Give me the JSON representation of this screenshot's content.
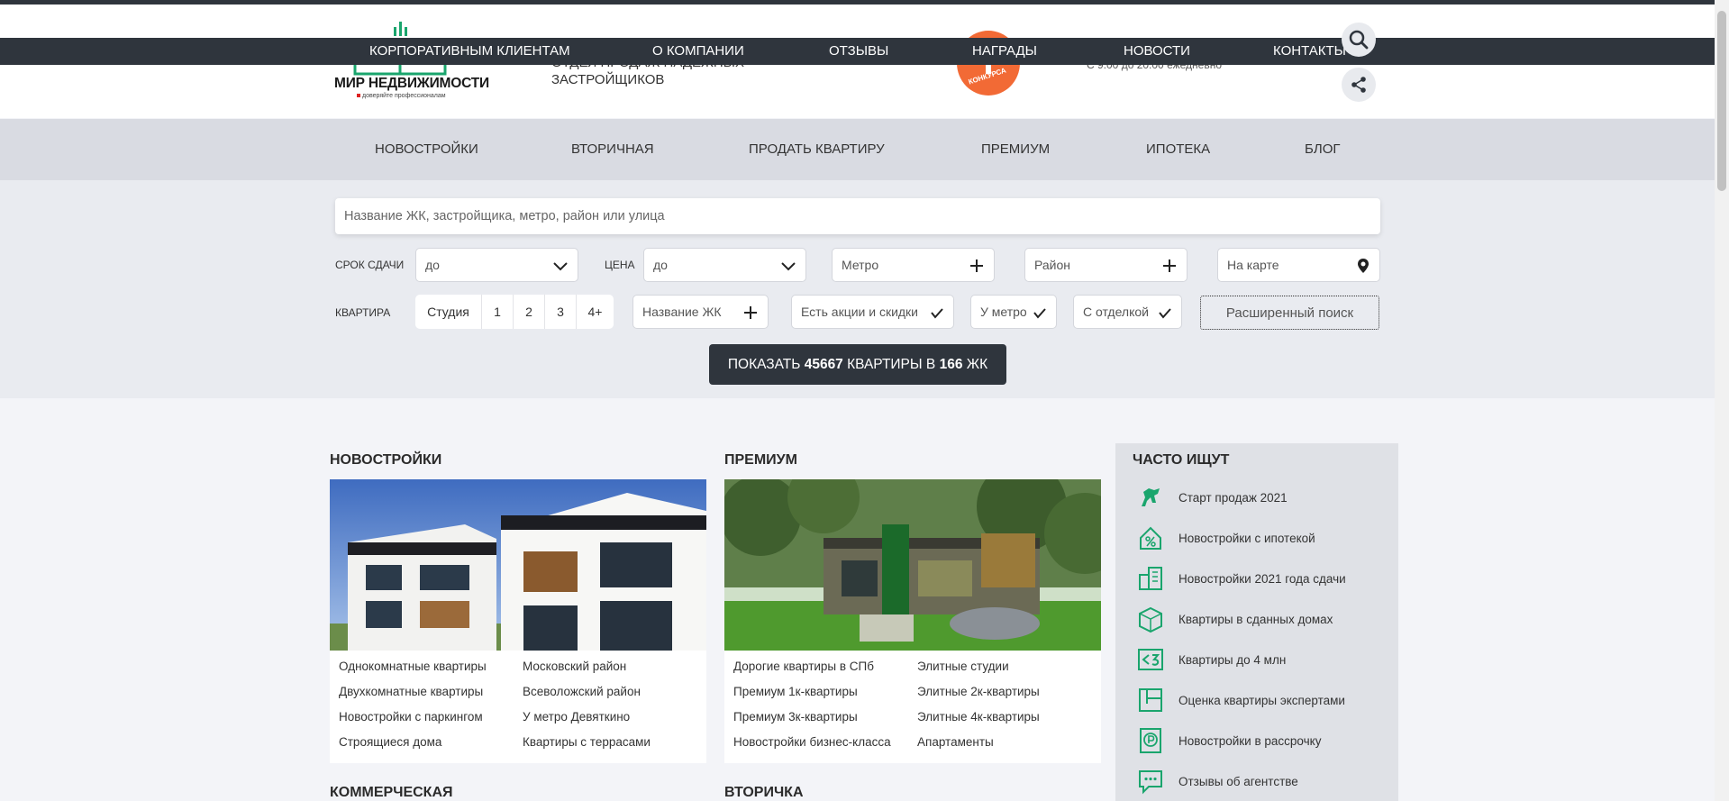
{
  "corp_nav": [
    "КОРПОРАТИВНЫМ КЛИЕНТАМ",
    "О КОМПАНИИ",
    "ОТЗЫВЫ",
    "НАГРАДЫ",
    "НОВОСТИ",
    "КОНТАКТЫ"
  ],
  "logo": {
    "name": "МИР НЕДВИЖИМОСТИ",
    "slogan": "доверяйте профессионалам"
  },
  "tagline": {
    "line1": "ОТДЕЛ ПРОДАЖ НАДЕЖНЫХ",
    "line2": "ЗАСТРОЙЩИКОВ"
  },
  "award_text": "КОНКУРСА",
  "hours": "С 9:00 до 20:00 ежедневно",
  "main_nav": [
    "НОВОСТРОЙКИ",
    "ВТОРИЧНАЯ",
    "ПРОДАТЬ КВАРТИРУ",
    "ПРЕМИУМ",
    "ИПОТЕКА",
    "БЛОГ"
  ],
  "search": {
    "placeholder": "Название ЖК, застройщика, метро, район или улица"
  },
  "filters": {
    "deadline_label": "СРОК СДАЧИ",
    "deadline_value": "до",
    "price_label": "ЦЕНА",
    "price_value": "до",
    "metro": "Метро",
    "district": "Район",
    "map": "На карте",
    "flat_label": "КВАРТИРА",
    "rooms": [
      "Студия",
      "1",
      "2",
      "3",
      "4+"
    ],
    "complex_name": "Название ЖК",
    "discounts": "Есть акции и скидки",
    "near_metro": "У метро",
    "finishing": "С отделкой",
    "extended": "Расширенный поиск"
  },
  "show_button": {
    "prefix": "ПОКАЗАТЬ ",
    "count": "45667",
    "middle": " КВАРТИРЫ В ",
    "complexes": "166",
    "suffix": " ЖК"
  },
  "sections": {
    "new": {
      "title": "НОВОСТРОЙКИ",
      "links": [
        "Однокомнатные квартиры",
        "Московский район",
        "Двухкомнатные квартиры",
        "Всеволожский район",
        "Новостройки с паркингом",
        "У метро Девяткино",
        "Строящиеся дома",
        "Квартиры с террасами"
      ]
    },
    "premium": {
      "title": "ПРЕМИУМ",
      "links": [
        "Дорогие квартиры в СПб",
        "Элитные студии",
        "Премиум 1к-квартиры",
        "Элитные 2к-квартиры",
        "Премиум 3к-квартиры",
        "Элитные 4к-квартиры",
        "Новостройки бизнес-класса",
        "Апартаменты"
      ]
    },
    "commercial": {
      "title": "КОММЕРЧЕСКАЯ"
    },
    "secondary": {
      "title": "ВТОРИЧКА"
    }
  },
  "popular": {
    "title": "ЧАСТО ИЩУТ",
    "items": [
      {
        "label": "Старт продаж 2021",
        "icon": "horse-icon"
      },
      {
        "label": "Новостройки с ипотекой",
        "icon": "house-percent-icon"
      },
      {
        "label": "Новостройки 2021 года сдачи",
        "icon": "buildings-icon"
      },
      {
        "label": "Квартиры в сданных домах",
        "icon": "cube-house-icon"
      },
      {
        "label": "Квартиры до 4 млн",
        "icon": "less-than-3-icon"
      },
      {
        "label": "Оценка квартиры экспертами",
        "icon": "floorplan-icon"
      },
      {
        "label": "Новостройки в рассрочку",
        "icon": "ruble-card-icon"
      },
      {
        "label": "Отзывы об агентстве",
        "icon": "chat-icon"
      }
    ]
  },
  "colors": {
    "accent": "#1aa56d",
    "dark": "#2f353d",
    "award": "#f26a35"
  }
}
